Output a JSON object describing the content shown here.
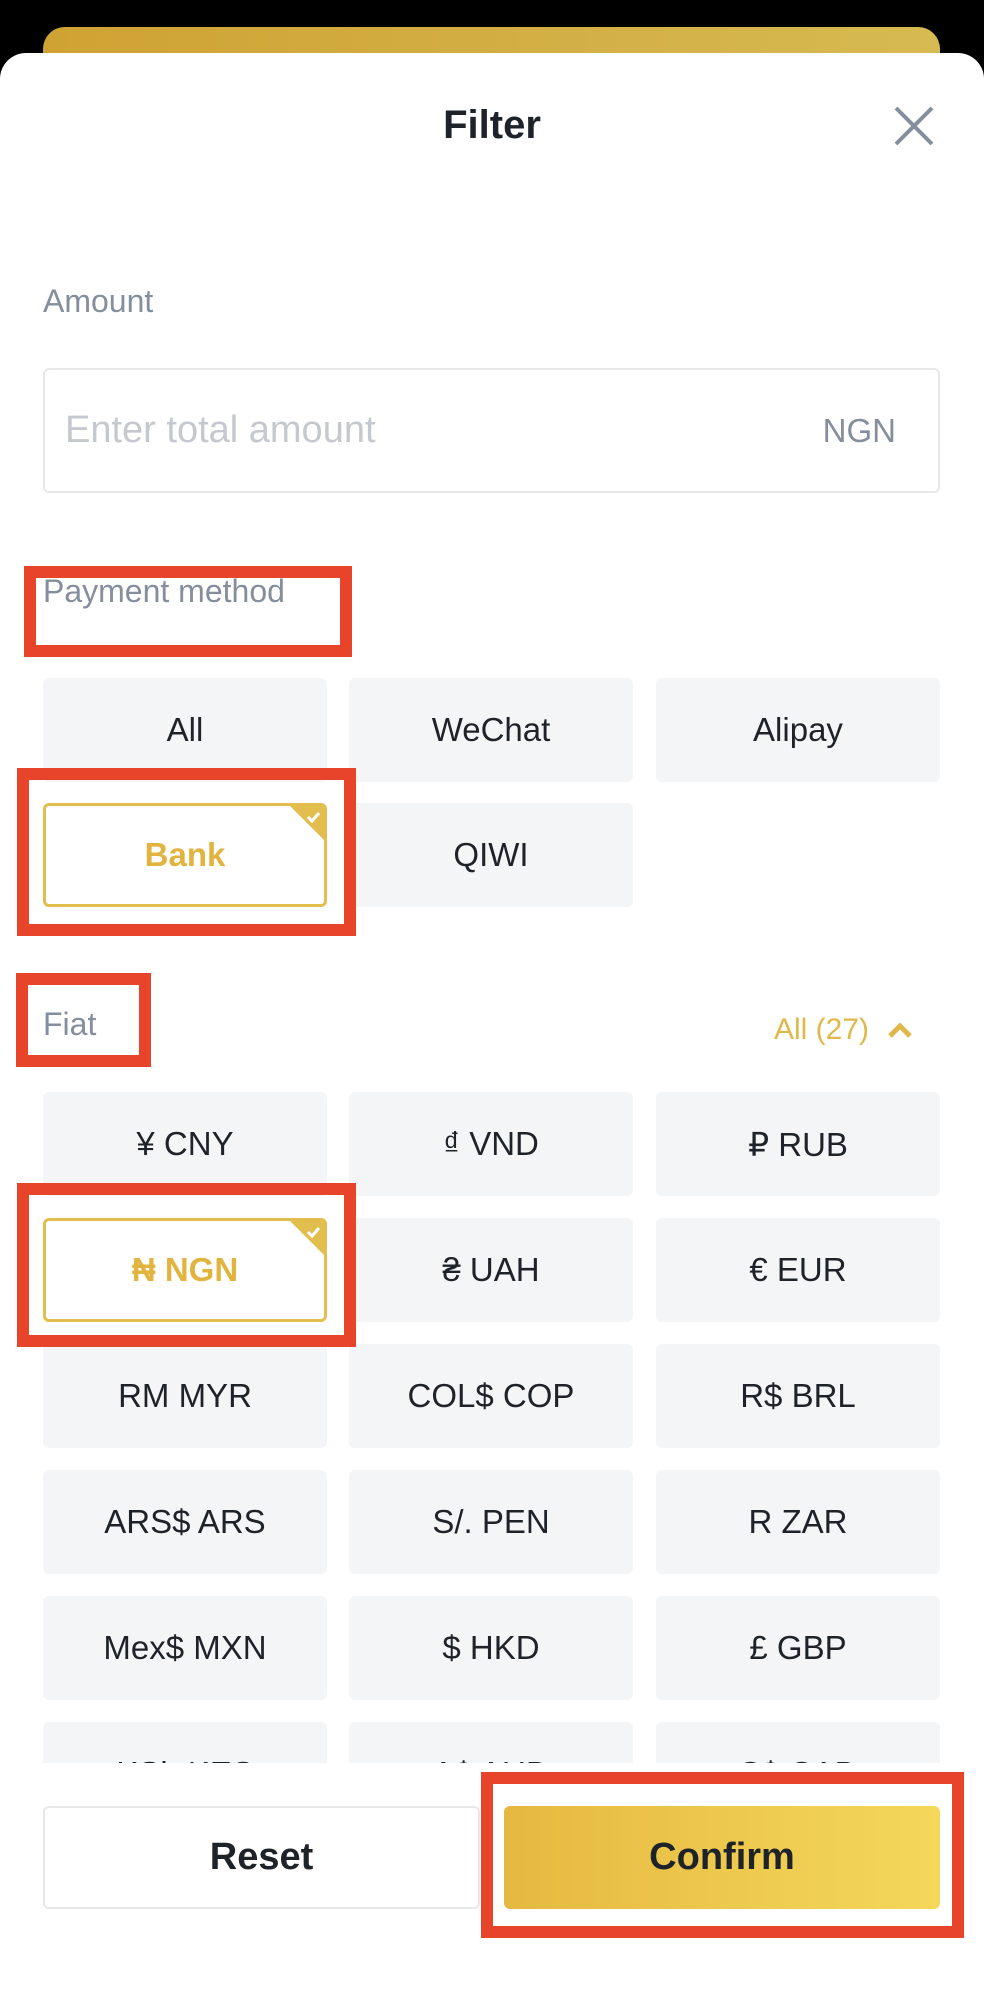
{
  "header": {
    "title": "Filter",
    "close_icon": "close-icon"
  },
  "amount": {
    "label": "Amount",
    "placeholder": "Enter total amount",
    "value": "",
    "unit": "NGN"
  },
  "payment_method": {
    "label": "Payment method",
    "options": [
      {
        "label": "All",
        "selected": false
      },
      {
        "label": "WeChat",
        "selected": false
      },
      {
        "label": "Alipay",
        "selected": false
      },
      {
        "label": "Bank",
        "selected": true
      },
      {
        "label": "QIWI",
        "selected": false
      }
    ]
  },
  "fiat": {
    "label": "Fiat",
    "toggle_label": "All (27)",
    "toggle_icon": "chevron-up-icon",
    "options": [
      {
        "label": "¥  CNY",
        "selected": false
      },
      {
        "label": "₫ VND",
        "selected": false
      },
      {
        "label": "₽ RUB",
        "selected": false
      },
      {
        "label": "₦ NGN",
        "selected": true
      },
      {
        "label": "₴ UAH",
        "selected": false
      },
      {
        "label": "€ EUR",
        "selected": false
      },
      {
        "label": "RM MYR",
        "selected": false
      },
      {
        "label": "COL$ COP",
        "selected": false
      },
      {
        "label": "R$ BRL",
        "selected": false
      },
      {
        "label": "ARS$ ARS",
        "selected": false
      },
      {
        "label": "S/. PEN",
        "selected": false
      },
      {
        "label": "R ZAR",
        "selected": false
      },
      {
        "label": "Mex$ MXN",
        "selected": false
      },
      {
        "label": "$ HKD",
        "selected": false
      },
      {
        "label": "£ GBP",
        "selected": false
      },
      {
        "label": "KSh KES",
        "selected": false
      },
      {
        "label": "A$ AUD",
        "selected": false
      },
      {
        "label": "C$ CAD",
        "selected": false
      }
    ]
  },
  "footer": {
    "reset_label": "Reset",
    "confirm_label": "Confirm"
  },
  "colors": {
    "accent": "#E0B84A",
    "highlight": "#E8442A",
    "text_primary": "#1E2329",
    "text_secondary": "#848E9C"
  }
}
